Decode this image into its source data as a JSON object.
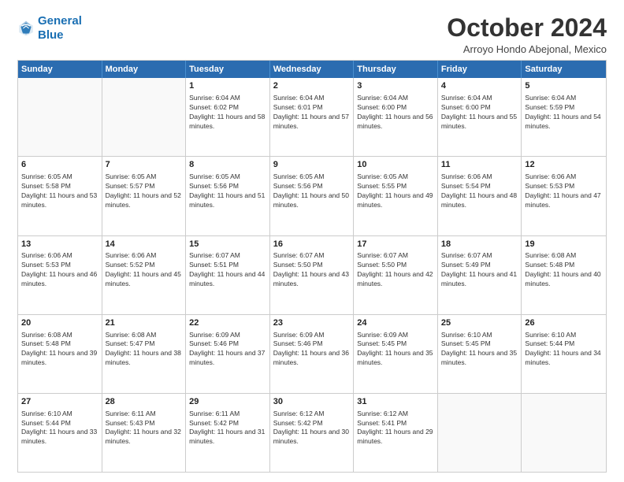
{
  "logo": {
    "line1": "General",
    "line2": "Blue"
  },
  "title": "October 2024",
  "location": "Arroyo Hondo Abejonal, Mexico",
  "header_days": [
    "Sunday",
    "Monday",
    "Tuesday",
    "Wednesday",
    "Thursday",
    "Friday",
    "Saturday"
  ],
  "weeks": [
    [
      {
        "day": "",
        "text": ""
      },
      {
        "day": "",
        "text": ""
      },
      {
        "day": "1",
        "text": "Sunrise: 6:04 AM\nSunset: 6:02 PM\nDaylight: 11 hours and 58 minutes."
      },
      {
        "day": "2",
        "text": "Sunrise: 6:04 AM\nSunset: 6:01 PM\nDaylight: 11 hours and 57 minutes."
      },
      {
        "day": "3",
        "text": "Sunrise: 6:04 AM\nSunset: 6:00 PM\nDaylight: 11 hours and 56 minutes."
      },
      {
        "day": "4",
        "text": "Sunrise: 6:04 AM\nSunset: 6:00 PM\nDaylight: 11 hours and 55 minutes."
      },
      {
        "day": "5",
        "text": "Sunrise: 6:04 AM\nSunset: 5:59 PM\nDaylight: 11 hours and 54 minutes."
      }
    ],
    [
      {
        "day": "6",
        "text": "Sunrise: 6:05 AM\nSunset: 5:58 PM\nDaylight: 11 hours and 53 minutes."
      },
      {
        "day": "7",
        "text": "Sunrise: 6:05 AM\nSunset: 5:57 PM\nDaylight: 11 hours and 52 minutes."
      },
      {
        "day": "8",
        "text": "Sunrise: 6:05 AM\nSunset: 5:56 PM\nDaylight: 11 hours and 51 minutes."
      },
      {
        "day": "9",
        "text": "Sunrise: 6:05 AM\nSunset: 5:56 PM\nDaylight: 11 hours and 50 minutes."
      },
      {
        "day": "10",
        "text": "Sunrise: 6:05 AM\nSunset: 5:55 PM\nDaylight: 11 hours and 49 minutes."
      },
      {
        "day": "11",
        "text": "Sunrise: 6:06 AM\nSunset: 5:54 PM\nDaylight: 11 hours and 48 minutes."
      },
      {
        "day": "12",
        "text": "Sunrise: 6:06 AM\nSunset: 5:53 PM\nDaylight: 11 hours and 47 minutes."
      }
    ],
    [
      {
        "day": "13",
        "text": "Sunrise: 6:06 AM\nSunset: 5:53 PM\nDaylight: 11 hours and 46 minutes."
      },
      {
        "day": "14",
        "text": "Sunrise: 6:06 AM\nSunset: 5:52 PM\nDaylight: 11 hours and 45 minutes."
      },
      {
        "day": "15",
        "text": "Sunrise: 6:07 AM\nSunset: 5:51 PM\nDaylight: 11 hours and 44 minutes."
      },
      {
        "day": "16",
        "text": "Sunrise: 6:07 AM\nSunset: 5:50 PM\nDaylight: 11 hours and 43 minutes."
      },
      {
        "day": "17",
        "text": "Sunrise: 6:07 AM\nSunset: 5:50 PM\nDaylight: 11 hours and 42 minutes."
      },
      {
        "day": "18",
        "text": "Sunrise: 6:07 AM\nSunset: 5:49 PM\nDaylight: 11 hours and 41 minutes."
      },
      {
        "day": "19",
        "text": "Sunrise: 6:08 AM\nSunset: 5:48 PM\nDaylight: 11 hours and 40 minutes."
      }
    ],
    [
      {
        "day": "20",
        "text": "Sunrise: 6:08 AM\nSunset: 5:48 PM\nDaylight: 11 hours and 39 minutes."
      },
      {
        "day": "21",
        "text": "Sunrise: 6:08 AM\nSunset: 5:47 PM\nDaylight: 11 hours and 38 minutes."
      },
      {
        "day": "22",
        "text": "Sunrise: 6:09 AM\nSunset: 5:46 PM\nDaylight: 11 hours and 37 minutes."
      },
      {
        "day": "23",
        "text": "Sunrise: 6:09 AM\nSunset: 5:46 PM\nDaylight: 11 hours and 36 minutes."
      },
      {
        "day": "24",
        "text": "Sunrise: 6:09 AM\nSunset: 5:45 PM\nDaylight: 11 hours and 35 minutes."
      },
      {
        "day": "25",
        "text": "Sunrise: 6:10 AM\nSunset: 5:45 PM\nDaylight: 11 hours and 35 minutes."
      },
      {
        "day": "26",
        "text": "Sunrise: 6:10 AM\nSunset: 5:44 PM\nDaylight: 11 hours and 34 minutes."
      }
    ],
    [
      {
        "day": "27",
        "text": "Sunrise: 6:10 AM\nSunset: 5:44 PM\nDaylight: 11 hours and 33 minutes."
      },
      {
        "day": "28",
        "text": "Sunrise: 6:11 AM\nSunset: 5:43 PM\nDaylight: 11 hours and 32 minutes."
      },
      {
        "day": "29",
        "text": "Sunrise: 6:11 AM\nSunset: 5:42 PM\nDaylight: 11 hours and 31 minutes."
      },
      {
        "day": "30",
        "text": "Sunrise: 6:12 AM\nSunset: 5:42 PM\nDaylight: 11 hours and 30 minutes."
      },
      {
        "day": "31",
        "text": "Sunrise: 6:12 AM\nSunset: 5:41 PM\nDaylight: 11 hours and 29 minutes."
      },
      {
        "day": "",
        "text": ""
      },
      {
        "day": "",
        "text": ""
      }
    ]
  ]
}
